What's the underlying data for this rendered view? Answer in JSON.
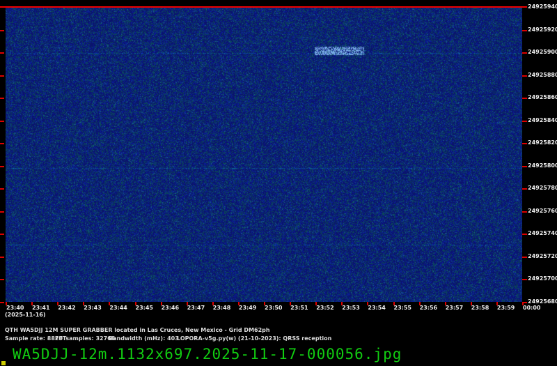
{
  "y_axis": {
    "labels": [
      "24925940",
      "24925920",
      "24925900",
      "24925880",
      "24925860",
      "24925840",
      "24925820",
      "24925800",
      "24925780",
      "24925760",
      "24925740",
      "24925720",
      "24925700",
      "24925680"
    ]
  },
  "x_axis": {
    "labels": [
      "23:40",
      "23:41",
      "23:42",
      "23:43",
      "23:44",
      "23:45",
      "23:46",
      "23:47",
      "23:48",
      "23:49",
      "23:50",
      "23:51",
      "23:52",
      "23:53",
      "23:54",
      "23:55",
      "23:56",
      "23:57",
      "23:58",
      "23:59",
      "00:00"
    ],
    "date": "(2025-11-16)"
  },
  "info": {
    "qth": "QTH WA5DJJ 12M SUPER GRABBER located in Las Cruces, New Mexico - Grid DM62ph",
    "sample_rate": "Sample rate: 8820",
    "fft": "FFTsamples: 32768",
    "bandwidth": "Bandwidth (mHz): 403",
    "software": "LOPORA-v5g.py(w) (21-10-2023): QRSS reception"
  },
  "filename": "WA5DJJ-12m.1132x697.2025-11-17-000056.jpg",
  "colors": {
    "background": "#0a1a7a",
    "tick": "#dd0000",
    "filename": "#11cc11"
  }
}
